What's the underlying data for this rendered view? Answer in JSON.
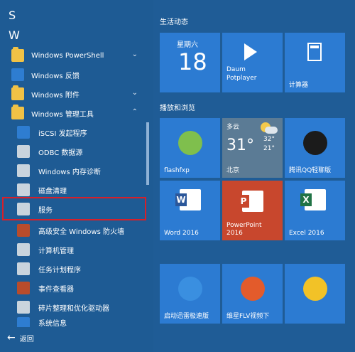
{
  "alpha": {
    "s": "S",
    "w": "W"
  },
  "list": {
    "powershell": "Windows PowerShell",
    "feedback": "Windows 反馈",
    "accessories": "Windows 附件",
    "admin_tools": "Windows 管理工具",
    "iscsi": "iSCSI 发起程序",
    "odbc": "ODBC 数据源",
    "memdiag": "Windows 内存诊断",
    "diskclean": "磁盘清理",
    "services": "服务",
    "firewall": "高级安全 Windows 防火墙",
    "compmgmt": "计算机管理",
    "tasksched": "任务计划程序",
    "eventvwr": "事件查看器",
    "defrag": "碎片整理和优化驱动器",
    "sysinfo": "系统信息"
  },
  "back_label": "返回",
  "groups": {
    "life": "生活动态",
    "play": "播放和浏览"
  },
  "tiles": {
    "calendar": {
      "dow": "星期六",
      "day": "18"
    },
    "daum": {
      "line1": "Daum",
      "line2": "Potplayer"
    },
    "calc": "计算器",
    "flashfxp": "flashfxp",
    "weather": {
      "cond": "多云",
      "temp": "31°",
      "hi": "32°",
      "lo": "21°",
      "city": "北京"
    },
    "qq": "腾讯QQ轻聊版",
    "word": "Word 2016",
    "ppt": {
      "line1": "PowerPoint",
      "line2": "2016"
    },
    "excel": "Excel 2016",
    "thunder": "启动迅雷极速版",
    "storm": "维星FLV视频下",
    "shapes": ""
  },
  "colors": {
    "start_bg": "#1e5b94",
    "tile_blue": "#2c7bd2",
    "ppt": "#c8472d",
    "excel": "#217346",
    "word": "#2b579a",
    "highlight": "#d6202a"
  }
}
